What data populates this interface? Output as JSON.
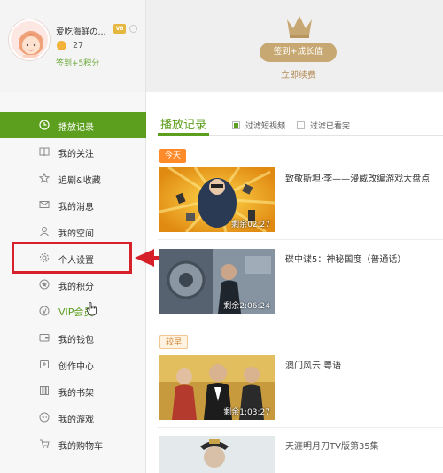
{
  "profile": {
    "username": "爱吃海鲜の...",
    "vip_level": "V6",
    "coins": "27",
    "sign_points": "签到+5积分"
  },
  "promo": {
    "sign_button": "签到+成长值",
    "renew_link": "立即续费"
  },
  "sidebar": {
    "items": [
      {
        "label": "播放记录",
        "icon": "clock-icon",
        "active": true
      },
      {
        "label": "我的关注",
        "icon": "book-icon"
      },
      {
        "label": "追剧&收藏",
        "icon": "star-icon"
      },
      {
        "label": "我的消息",
        "icon": "mail-icon"
      },
      {
        "label": "我的空间",
        "icon": "user-icon"
      },
      {
        "label": "个人设置",
        "icon": "gear-icon",
        "highlighted": true
      },
      {
        "label": "我的积分",
        "icon": "points-icon"
      },
      {
        "label": "VIP会员",
        "icon": "vip-icon"
      },
      {
        "label": "我的钱包",
        "icon": "wallet-icon"
      },
      {
        "label": "创作中心",
        "icon": "create-icon"
      },
      {
        "label": "我的书架",
        "icon": "bookshelf-icon"
      },
      {
        "label": "我的游戏",
        "icon": "game-icon"
      },
      {
        "label": "我的购物车",
        "icon": "cart-icon"
      }
    ]
  },
  "main": {
    "title": "播放记录",
    "filters": [
      {
        "label": "过滤短视频",
        "checked": true
      },
      {
        "label": "过滤已看完",
        "checked": false
      }
    ],
    "groups": [
      {
        "tag": "今天"
      },
      {
        "tag": "较早"
      }
    ],
    "videos": [
      {
        "title": "致敬斯坦·李——漫威改编游戏大盘点",
        "remaining": "剩余02:27"
      },
      {
        "title": "碟中谍5：神秘国度（普通话）",
        "remaining": "剩余2:06:24"
      },
      {
        "title": "澳门风云 粤语",
        "remaining": "剩余1:03:27"
      },
      {
        "title": "天涯明月刀TV版第35集",
        "remaining": ""
      }
    ]
  },
  "colors": {
    "accent": "#5c9e1e",
    "highlight": "#d6202a",
    "gold": "#c8a872"
  }
}
